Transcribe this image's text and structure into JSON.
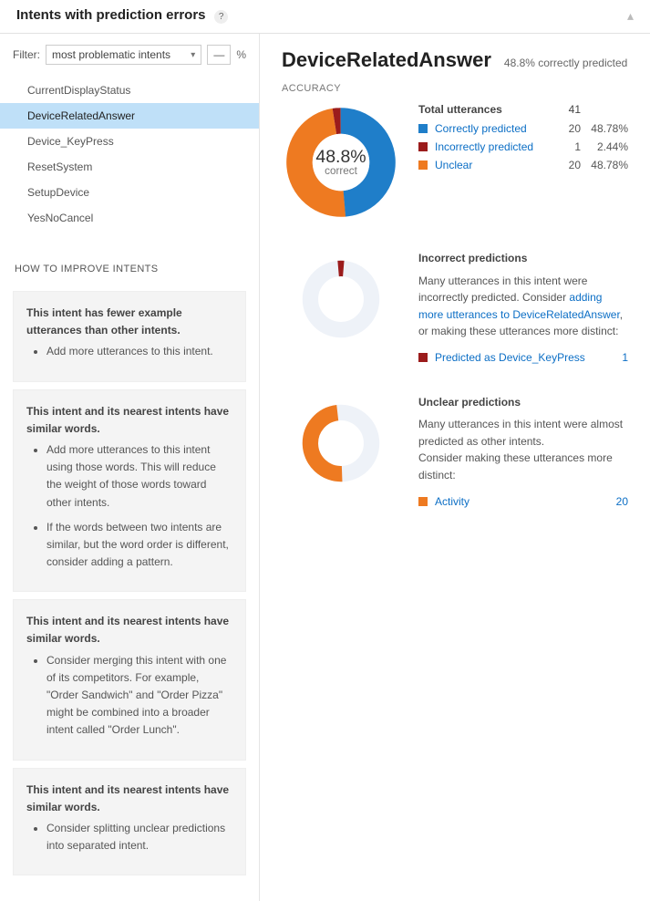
{
  "header": {
    "title": "Intents with prediction errors",
    "help": "?"
  },
  "filter": {
    "label": "Filter:",
    "selected": "most problematic intents",
    "dash": "—",
    "pct": "%"
  },
  "intents": {
    "items": [
      {
        "label": "CurrentDisplayStatus"
      },
      {
        "label": "DeviceRelatedAnswer"
      },
      {
        "label": "Device_KeyPress"
      },
      {
        "label": "ResetSystem"
      },
      {
        "label": "SetupDevice"
      },
      {
        "label": "YesNoCancel"
      }
    ],
    "selected_index": 1
  },
  "howto": {
    "heading": "HOW TO IMPROVE INTENTS",
    "tips": [
      {
        "title": "This intent has fewer example utterances than other intents.",
        "bullets": [
          "Add more utterances to this intent."
        ]
      },
      {
        "title": "This intent and its nearest intents have similar words.",
        "bullets": [
          "Add more utterances to this intent using those words. This will reduce the weight of those words toward other intents.",
          "If the words between two intents are similar, but the word order is different, consider adding a pattern."
        ]
      },
      {
        "title": "This intent and its nearest intents have similar words.",
        "bullets": [
          "Consider merging this intent with one of its competitors. For example, \"Order Sandwich\" and \"Order Pizza\" might be combined into a broader intent called \"Order Lunch\"."
        ]
      },
      {
        "title": "This intent and its nearest intents have similar words.",
        "bullets": [
          "Consider splitting unclear predictions into separated intent."
        ]
      }
    ]
  },
  "detail": {
    "title": "DeviceRelatedAnswer",
    "subtitle": "48.8% correctly predicted",
    "accuracy_label": "ACCURACY",
    "donut": {
      "center_main": "48.8%",
      "center_sub": "correct"
    },
    "totals": {
      "label": "Total utterances",
      "value": "41",
      "rows": [
        {
          "label": "Correctly predicted",
          "count": "20",
          "pct": "48.78%",
          "color": "blue",
          "link": true
        },
        {
          "label": "Incorrectly predicted",
          "count": "1",
          "pct": "2.44%",
          "color": "darkred",
          "link": true
        },
        {
          "label": "Unclear",
          "count": "20",
          "pct": "48.78%",
          "color": "orange",
          "link": true
        }
      ]
    },
    "incorrect": {
      "title": "Incorrect predictions",
      "text_pre": "Many utterances in this intent were incorrectly predicted. Consider ",
      "link1": "adding more utterances to DeviceRelatedAnswer",
      "text_post": ", or making these utterances more distinct:",
      "rows": [
        {
          "label": "Predicted as Device_KeyPress",
          "count": "1",
          "color": "darkred"
        }
      ]
    },
    "unclear": {
      "title": "Unclear predictions",
      "text1": "Many utterances in this intent were almost predicted as other intents.",
      "text2": "Consider making these utterances more distinct:",
      "rows": [
        {
          "label": "Activity",
          "count": "20",
          "color": "orange"
        }
      ]
    }
  },
  "chart_data": [
    {
      "type": "pie",
      "title": "Accuracy",
      "series": [
        {
          "name": "Correctly predicted",
          "value": 20,
          "pct": 48.78,
          "color": "#1f7ec9"
        },
        {
          "name": "Incorrectly predicted",
          "value": 1,
          "pct": 2.44,
          "color": "#9b1c1c"
        },
        {
          "name": "Unclear",
          "value": 20,
          "pct": 48.78,
          "color": "#ee7a21"
        }
      ],
      "center_label": "48.8% correct",
      "total": 41
    },
    {
      "type": "pie",
      "title": "Incorrect predictions",
      "series": [
        {
          "name": "Predicted as Device_KeyPress",
          "value": 1,
          "color": "#9b1c1c"
        },
        {
          "name": "Other",
          "value": 40,
          "color": "#e8eef5"
        }
      ]
    },
    {
      "type": "pie",
      "title": "Unclear predictions",
      "series": [
        {
          "name": "Activity",
          "value": 20,
          "color": "#ee7a21"
        },
        {
          "name": "Other",
          "value": 21,
          "color": "#e8eef5"
        }
      ]
    }
  ]
}
